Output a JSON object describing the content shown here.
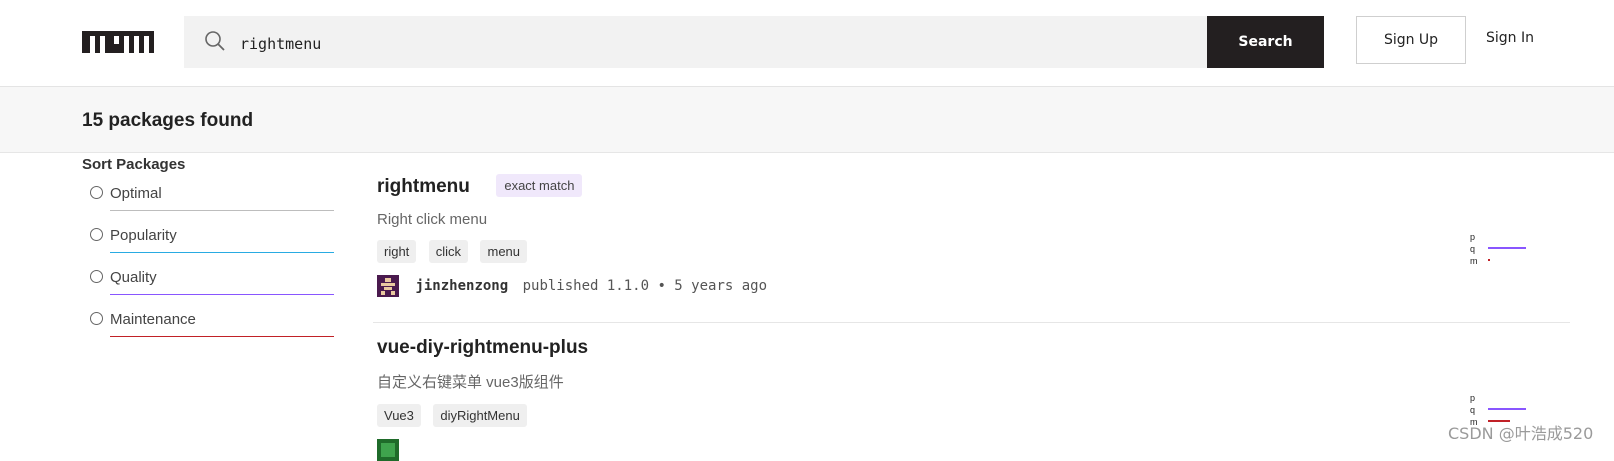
{
  "header": {
    "logo_text": "npm",
    "search_value": "rightmenu",
    "search_button": "Search",
    "signup": "Sign Up",
    "signin": "Sign In"
  },
  "results": {
    "count_text": "15 packages found"
  },
  "sidebar": {
    "title": "Sort Packages",
    "options": [
      {
        "label": "Optimal",
        "color": "#bdbdbd"
      },
      {
        "label": "Popularity",
        "color": "#29abe2"
      },
      {
        "label": "Quality",
        "color": "#8956ff"
      },
      {
        "label": "Maintenance",
        "color": "#c12127"
      }
    ]
  },
  "packages": [
    {
      "name": "rightmenu",
      "badge": "exact match",
      "description": "Right click menu",
      "tags": [
        "right",
        "click",
        "menu"
      ],
      "author": "jinzhenzong",
      "published": "published 1.1.0 • 5 years ago",
      "score_labels": [
        "p",
        "q",
        "m"
      ]
    },
    {
      "name": "vue-diy-rightmenu-plus",
      "description": "自定义右键菜单 vue3版组件",
      "tags": [
        "Vue3",
        "diyRightMenu"
      ],
      "score_labels": [
        "p",
        "q",
        "m"
      ]
    }
  ],
  "watermark": "CSDN @叶浩成520"
}
